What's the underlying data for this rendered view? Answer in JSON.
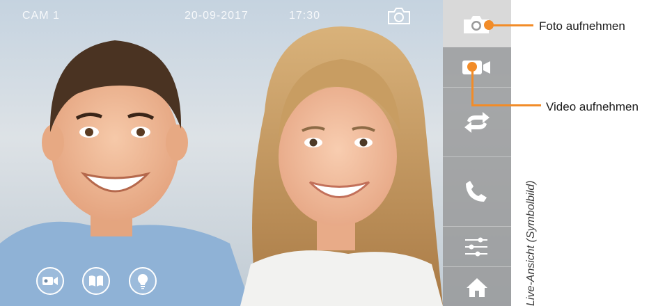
{
  "status_bar": {
    "camera": "CAM 1",
    "date": "20-09-2017",
    "time": "17:30",
    "indicator_icon": "camera-outline-icon"
  },
  "quick_actions": [
    {
      "icon": "video-camera-icon"
    },
    {
      "icon": "book-icon"
    },
    {
      "icon": "light-bulb-icon"
    }
  ],
  "toolbar": {
    "items": [
      {
        "icon": "photo-camera-icon",
        "active": true
      },
      {
        "icon": "video-record-icon"
      },
      {
        "icon": "switch-arrows-icon"
      },
      {
        "icon": "phone-icon"
      },
      {
        "icon": "settings-sliders-icon"
      },
      {
        "icon": "home-icon"
      }
    ]
  },
  "callouts": {
    "photo": "Foto aufnehmen",
    "video": "Video aufnehmen"
  },
  "caption": "Live-Ansicht (Symbolbild)",
  "colors": {
    "accent": "#f28c28",
    "toolbar_bg": "#969696",
    "toolbar_active": "#d9d9d9"
  }
}
